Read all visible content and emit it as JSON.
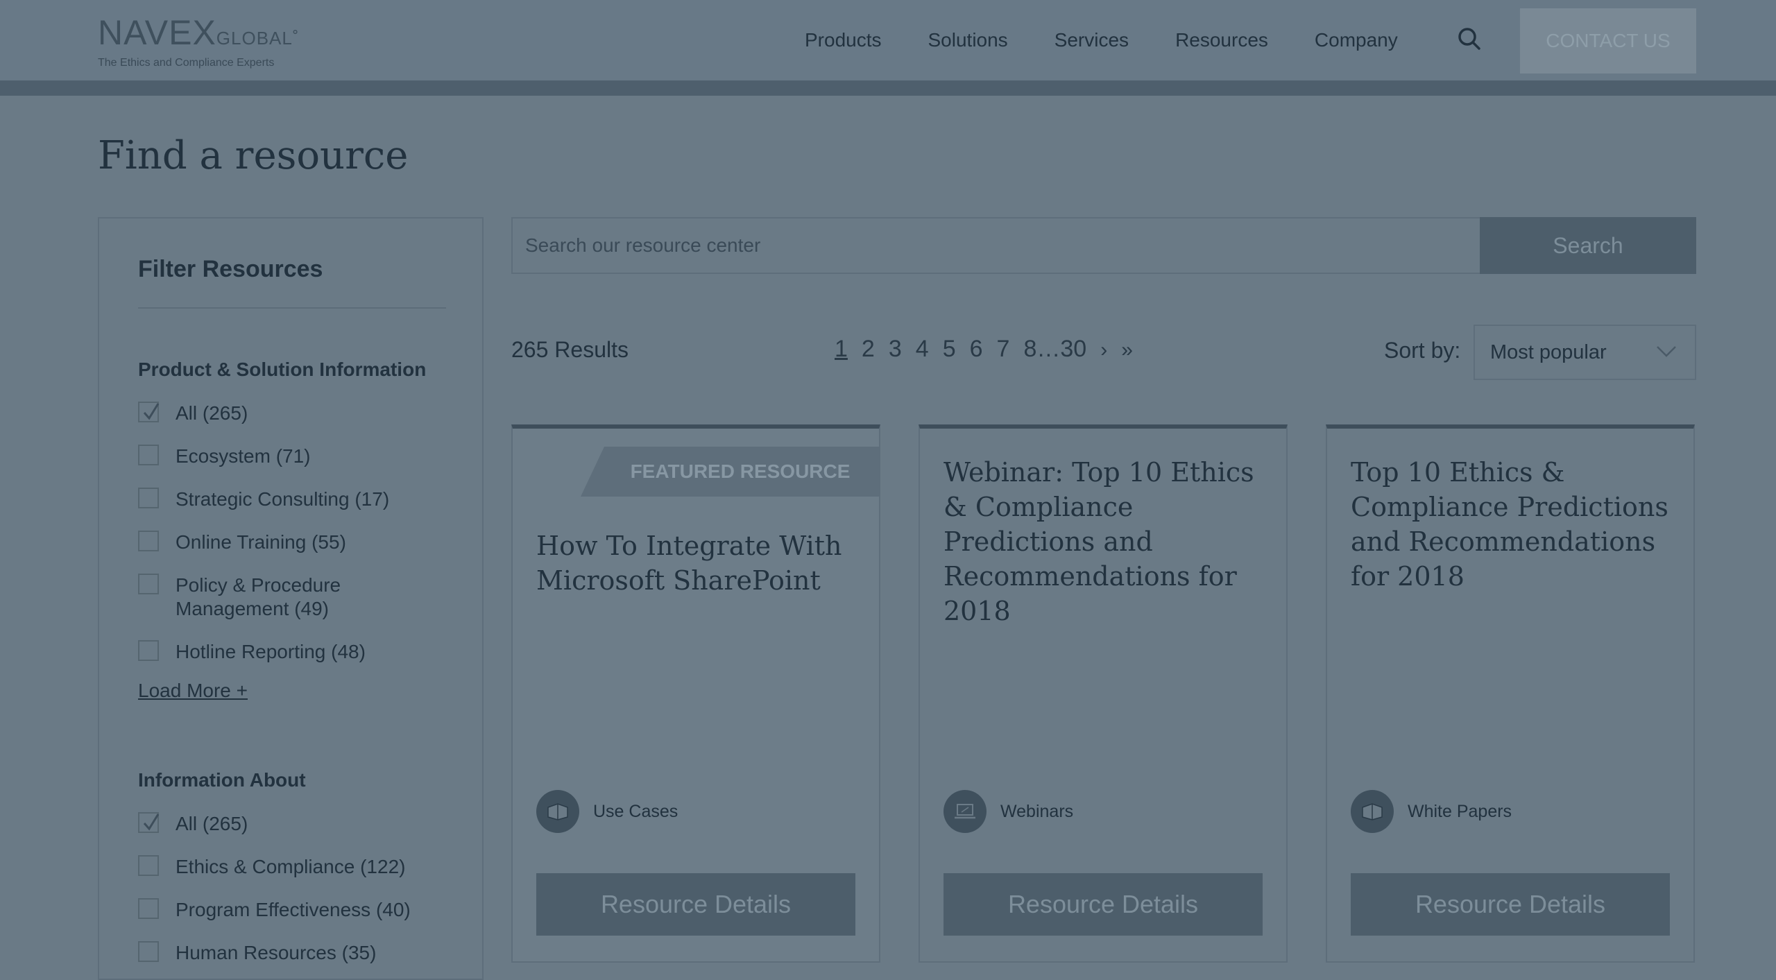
{
  "header": {
    "logo_main": "NAVEX",
    "logo_global": "GLOBAL",
    "logo_tagline": "The Ethics and Compliance Experts",
    "nav": [
      "Products",
      "Solutions",
      "Services",
      "Resources",
      "Company"
    ],
    "contact_label": "CONTACT US"
  },
  "page": {
    "title": "Find a resource"
  },
  "sidebar": {
    "title": "Filter Resources",
    "groups": [
      {
        "title": "Product & Solution Information",
        "items": [
          {
            "label": "All (265)",
            "checked": true
          },
          {
            "label": "Ecosystem (71)",
            "checked": false
          },
          {
            "label": "Strategic Consulting (17)",
            "checked": false
          },
          {
            "label": "Online Training (55)",
            "checked": false
          },
          {
            "label": "Policy & Procedure Management (49)",
            "checked": false
          },
          {
            "label": "Hotline Reporting (48)",
            "checked": false
          }
        ],
        "load_more": "Load More +"
      },
      {
        "title": "Information About",
        "items": [
          {
            "label": "All (265)",
            "checked": true
          },
          {
            "label": "Ethics & Compliance (122)",
            "checked": false
          },
          {
            "label": "Program Effectiveness (40)",
            "checked": false
          },
          {
            "label": "Human Resources (35)",
            "checked": false
          }
        ]
      }
    ]
  },
  "search": {
    "placeholder": "Search our resource center",
    "button": "Search"
  },
  "results": {
    "count": "265 Results",
    "pages": [
      "1",
      "2",
      "3",
      "4",
      "5",
      "6",
      "7",
      "8…30",
      "›",
      "»"
    ],
    "current_page": "1",
    "sort_label": "Sort by:",
    "sort_value": "Most popular"
  },
  "cards": [
    {
      "ribbon": "FEATURED RESOURCE",
      "title": "How To Integrate With Microsoft SharePoint",
      "type": "Use Cases",
      "icon": "book-icon",
      "button": "Resource Details"
    },
    {
      "title": "Webinar: Top 10 Ethics & Compliance Predictions and Recommendations for 2018",
      "type": "Webinars",
      "icon": "laptop-icon",
      "button": "Resource Details"
    },
    {
      "title": "Top 10 Ethics & Compliance Predictions and Recommendations for 2018",
      "type": "White Papers",
      "icon": "book-icon",
      "button": "Resource Details"
    }
  ]
}
